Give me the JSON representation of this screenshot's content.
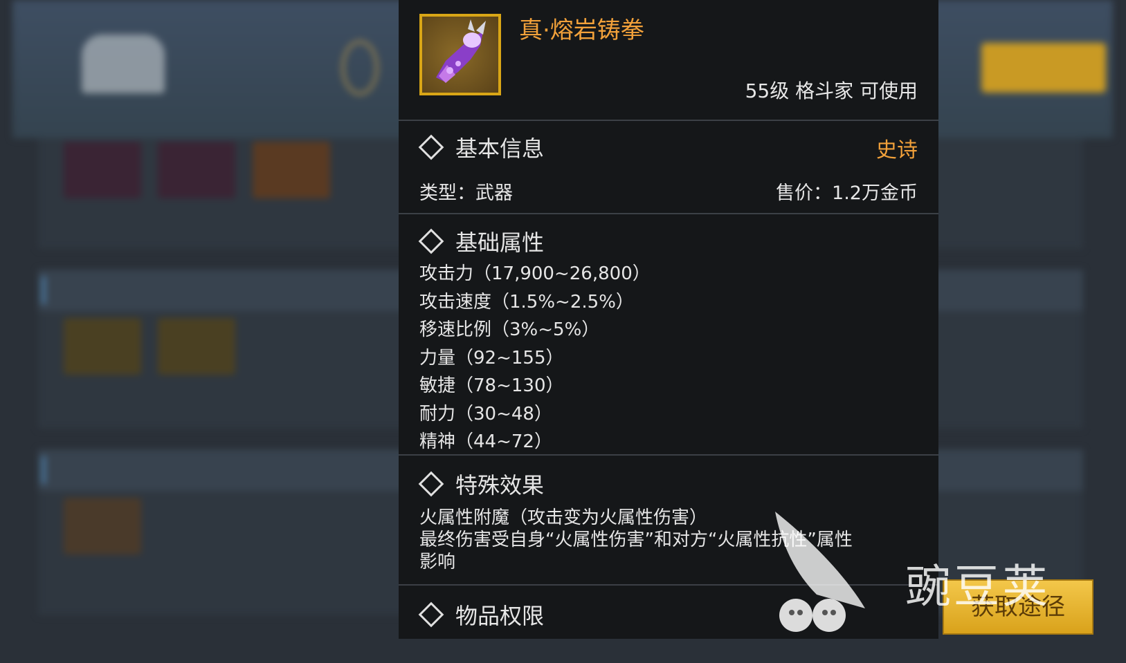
{
  "item": {
    "name": "真·熔岩铸拳",
    "requirement": "55级 格斗家 可使用",
    "icon": "gauntlet-icon"
  },
  "basic_info": {
    "title": "基本信息",
    "rarity": "史诗",
    "type": "类型：武器",
    "price": "售价：1.2万金币"
  },
  "base_attributes": {
    "title": "基础属性",
    "items": [
      "攻击力（17,900~26,800）",
      "攻击速度（1.5%~2.5%）",
      "移速比例（3%~5%）",
      "力量（92~155）",
      "敏捷（78~130）",
      "耐力（30~48）",
      "精神（44~72）"
    ]
  },
  "special_effects": {
    "title": "特殊效果",
    "lines": [
      "火属性附魔（攻击变为火属性伤害）",
      "最终伤害受自身“火属性伤害”和对方“火属性抗性”属性",
      "影响"
    ]
  },
  "item_permission": {
    "title": "物品权限"
  },
  "acquire_button": {
    "label": "获取途径"
  },
  "watermark": {
    "text": "豌豆荚"
  },
  "colors": {
    "accent": "#f2a13a",
    "panel_bg": "#151719",
    "button": "#e8b22c"
  }
}
